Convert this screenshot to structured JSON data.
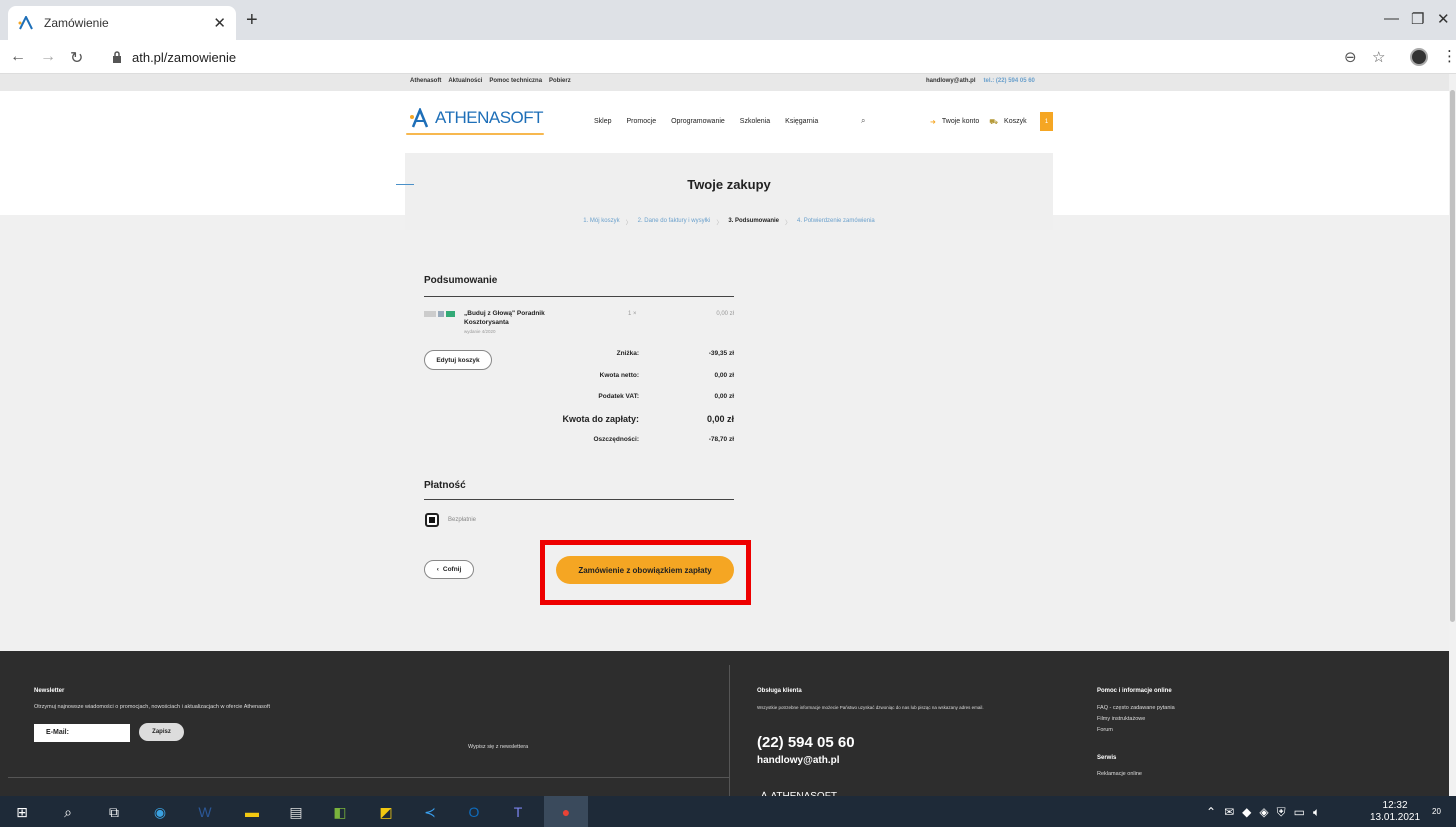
{
  "browser": {
    "tab_title": "Zamówienie",
    "url": "ath.pl/zamowienie"
  },
  "topbar": {
    "links": [
      "Athenasoft",
      "Aktualności",
      "Pomoc techniczna",
      "Pobierz"
    ],
    "email": "handlowy@ath.pl",
    "phone": "tel.: (22) 594 05 60"
  },
  "header": {
    "logo_text": "ATHENASOFT",
    "nav": [
      "Sklep",
      "Promocje",
      "Oprogramowanie",
      "Szkolenia",
      "Księgarnia"
    ],
    "account": "Twoje konto",
    "cart": "Koszyk",
    "cart_count": "1"
  },
  "hero": {
    "title": "Twoje zakupy",
    "steps": [
      "1. Mój koszyk",
      "2. Dane do faktury i wysyłki",
      "3. Podsumowanie",
      "4. Potwierdzenie zamówienia"
    ],
    "active_step": 2
  },
  "summary": {
    "title": "Podsumowanie",
    "product": {
      "name": "„Buduj z Głową\" Poradnik Kosztorysanta",
      "subtitle": "wydanie 4/2020",
      "qty": "1 ×",
      "price": "0,00 zł"
    },
    "edit_cart": "Edytuj koszyk",
    "totals": [
      {
        "label": "Zniżka:",
        "value": "-39,35 zł"
      },
      {
        "label": "Kwota netto:",
        "value": "0,00 zł"
      },
      {
        "label": "Podatek VAT:",
        "value": "0,00 zł"
      },
      {
        "label": "Kwota do zapłaty:",
        "value": "0,00 zł"
      },
      {
        "label": "Oszczędności:",
        "value": "-78,70 zł"
      }
    ]
  },
  "payment": {
    "title": "Płatność",
    "option": "Bezpłatnie",
    "back": "Cofnij",
    "order_button": "Zamówienie z obowiązkiem zapłaty"
  },
  "footer": {
    "newsletter_title": "Newsletter",
    "newsletter_text": "Otrzymuj najnowsze wiadomości o promocjach, nowościach i aktualizacjach w ofercie Athenasoft",
    "email_placeholder": "E-Mail:",
    "subscribe": "Zapisz",
    "unsubscribe": "Wypisz się z newslettera",
    "service_title": "Obsługa klienta",
    "service_text": "Wszystkie potrzebne informacje możecie Państwo uzyskać dzwoniąc do nas lub pisząc na wskazany adres email.",
    "phone": "(22) 594 05 60",
    "email": "handlowy@ath.pl",
    "help_title": "Pomoc i informacje online",
    "help_links": [
      "FAQ - często zadawane pytania",
      "Filmy instruktażowe",
      "Forum"
    ],
    "service2_title": "Serwis",
    "service2_links": [
      "Reklamacje online"
    ],
    "logo_text": "ATHENASOFT"
  },
  "taskbar": {
    "time": "12:32",
    "date": "13.01.2021",
    "notif_count": "20"
  }
}
